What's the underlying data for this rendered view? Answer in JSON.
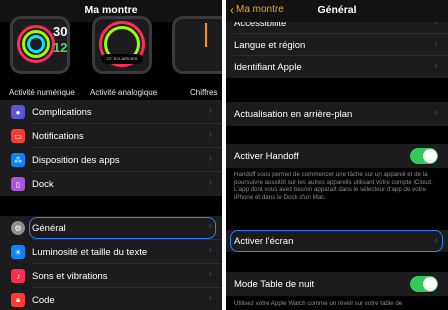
{
  "left": {
    "nav_title": "Ma montre",
    "faces": [
      {
        "label": "Activité numérique",
        "time_top": "30",
        "time_bottom": "12"
      },
      {
        "label": "Activité analogique",
        "badge": "22° ÉCLAIRCIES"
      },
      {
        "label": "Chiffres"
      }
    ],
    "items_group1": [
      {
        "label": "Complications",
        "icon": "complications-icon",
        "color": "#5856d6"
      },
      {
        "label": "Notifications",
        "icon": "notifications-icon",
        "color": "#ff3b30"
      },
      {
        "label": "Disposition des apps",
        "icon": "app-layout-icon",
        "color": "#0a84ff"
      },
      {
        "label": "Dock",
        "icon": "dock-icon",
        "color": "#af52de"
      }
    ],
    "items_group2": [
      {
        "label": "Général",
        "icon": "gear-icon",
        "color": "#8e8e93"
      },
      {
        "label": "Luminosité et taille du texte",
        "icon": "brightness-icon",
        "color": "#0a84ff"
      },
      {
        "label": "Sons et vibrations",
        "icon": "speaker-icon",
        "color": "#ff2d55"
      },
      {
        "label": "Code",
        "icon": "lock-icon",
        "color": "#ff3b30"
      }
    ]
  },
  "right": {
    "back_label": "Ma montre",
    "nav_title": "Général",
    "top_cut_item": "Accessibilité",
    "group1": [
      "Langue et région",
      "Identifiant Apple"
    ],
    "background_refresh": "Actualisation en arrière-plan",
    "handoff_label": "Activer Handoff",
    "handoff_on": true,
    "handoff_desc": "Handoff vous permet de commencer une tâche sur un appareil et de la poursuivre aussitôt sur les autres appareils utilisant votre compte iCloud. L'app dont vous avez besoin apparaît dans le sélecteur d'app de votre iPhone et dans le Dock d'un Mac.",
    "wake_screen": "Activer l'écran",
    "nightstand_label": "Mode Table de nuit",
    "nightstand_on": true,
    "nightstand_desc": "Utilisez votre Apple Watch comme un réveil sur votre table de"
  },
  "colors": {
    "accent": "#f5a623",
    "highlight": "#2d7ff9",
    "toggle_on": "#34c759"
  }
}
